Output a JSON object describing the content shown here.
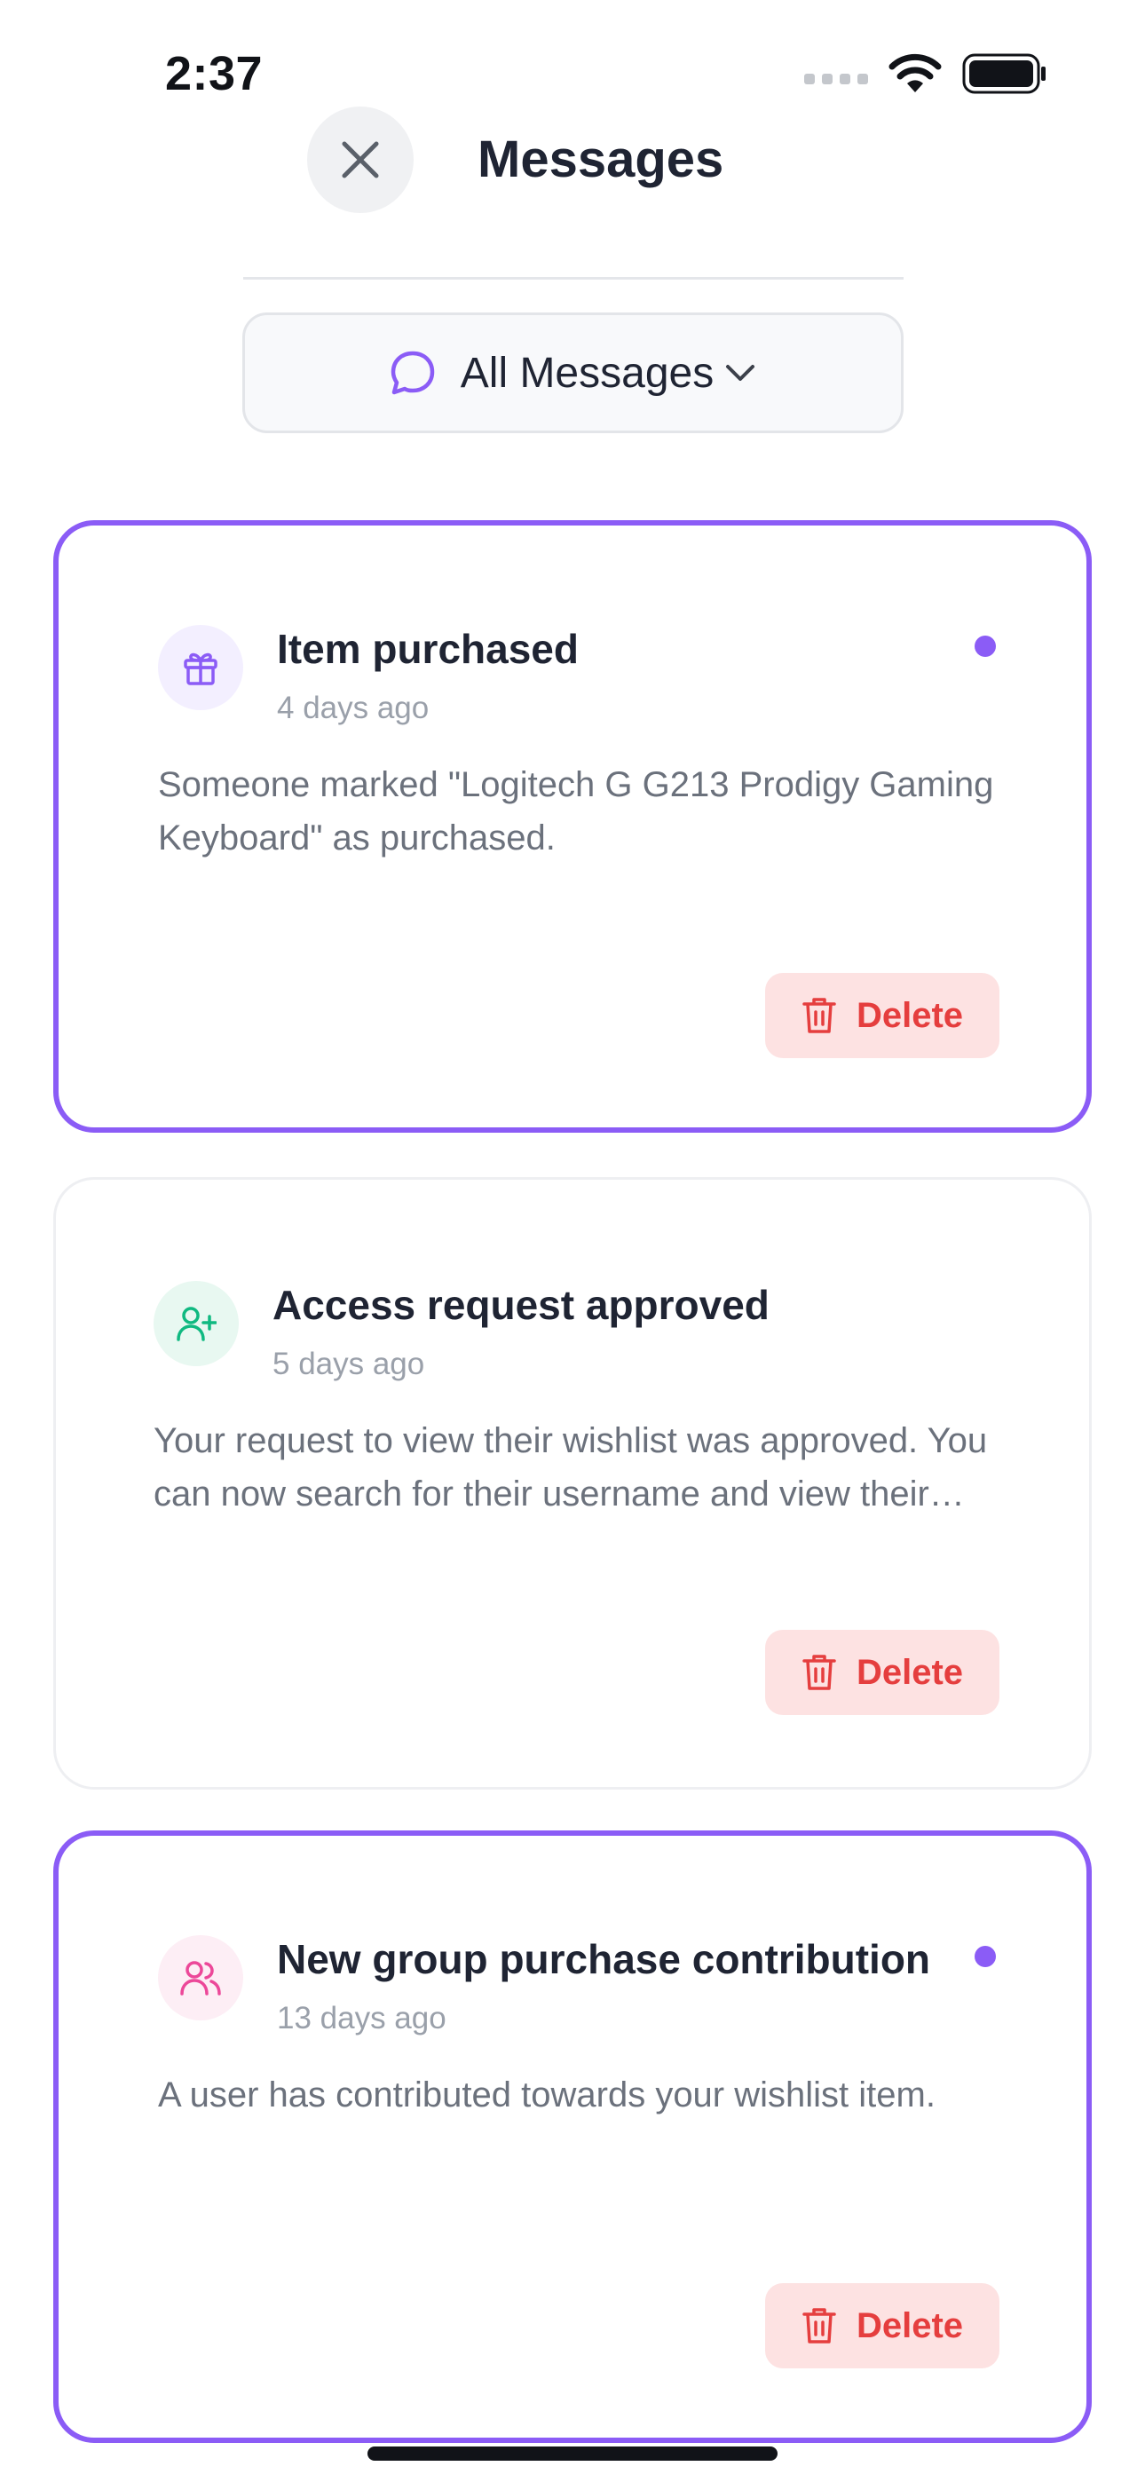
{
  "status_bar": {
    "time": "2:37"
  },
  "header": {
    "title": "Messages",
    "close_icon": "close-icon"
  },
  "filter": {
    "label": "All Messages",
    "icon": "message-bubble-icon",
    "chevron": "chevron-down-icon"
  },
  "colors": {
    "accent": "#8b5cf6",
    "danger": "#e53e3e",
    "danger_bg": "#fde2e2",
    "success": "#10b981",
    "pink": "#ec4899"
  },
  "messages": [
    {
      "title": "Item purchased",
      "time": "4 days ago",
      "body": "Someone marked \"Logitech G G213 Prodigy Gaming Keyboard\" as purchased.",
      "icon": "gift-icon",
      "unread": true,
      "delete_label": "Delete"
    },
    {
      "title": "Access request approved",
      "time": "5 days ago",
      "body": "Your request to view their wishlist was approved. You can now search for their username and view their wishlist.",
      "icon": "user-plus-icon",
      "unread": false,
      "delete_label": "Delete"
    },
    {
      "title": "New group purchase contribution",
      "time": "13 days ago",
      "body": "A user has contributed towards your wishlist item.",
      "icon": "users-icon",
      "unread": true,
      "delete_label": "Delete"
    }
  ]
}
